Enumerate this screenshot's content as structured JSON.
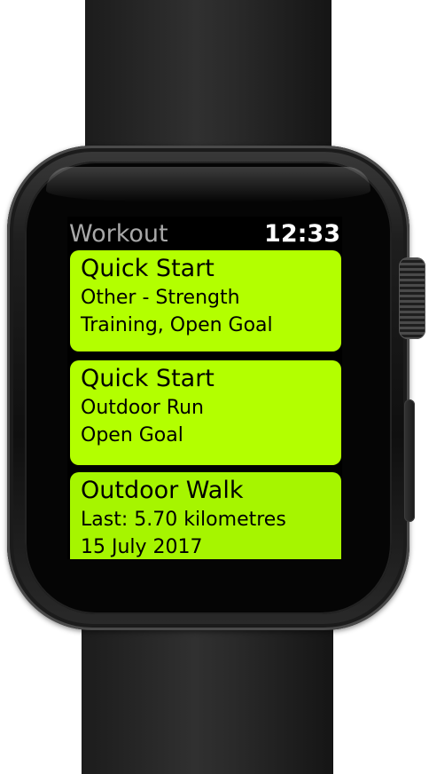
{
  "status_bar": {
    "app_title": "Workout",
    "time": "12:33"
  },
  "workouts": [
    {
      "title": "Quick Start",
      "line1": "Other - Strength",
      "line2": "Training, Open Goal"
    },
    {
      "title": "Quick Start",
      "line1": "Outdoor Run",
      "line2": "Open Goal"
    },
    {
      "title": "Outdoor Walk",
      "line1": "Last: 5.70 kilometres",
      "line2": "15 July 2017"
    }
  ],
  "colors": {
    "card_accent": "#b3ff00",
    "screen_background": "#000000",
    "title_gray": "#a8a8a8"
  }
}
